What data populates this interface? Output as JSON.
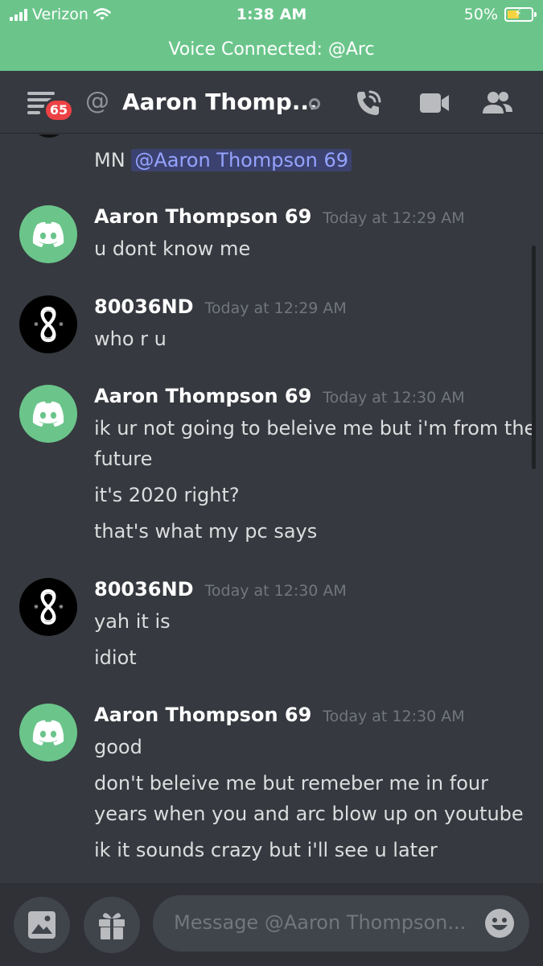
{
  "status_bar": {
    "carrier": "Verizon",
    "time": "1:38 AM",
    "battery": "50%"
  },
  "voice_bar": {
    "text": "Voice Connected: @Arc"
  },
  "header": {
    "badge_count": "65",
    "channel_name": "Aaron Thomp..."
  },
  "messages": {
    "partial": {
      "text": "MN",
      "mention": "@Aaron Thompson 69"
    },
    "groups": [
      {
        "author": "Aaron Thompson 69",
        "timestamp": "Today at 12:29 AM",
        "avatar": "discord-logo",
        "lines": [
          "u dont know me"
        ]
      },
      {
        "author": "80036ND",
        "timestamp": "Today at 12:29 AM",
        "avatar": "infinity-logo",
        "lines": [
          "who r u"
        ]
      },
      {
        "author": "Aaron Thompson 69",
        "timestamp": "Today at 12:30 AM",
        "avatar": "discord-logo",
        "lines": [
          "ik ur not going to beleive me but i'm from the",
          "future",
          "it's 2020 right?",
          "that's what my pc says"
        ]
      },
      {
        "author": "80036ND",
        "timestamp": "Today at 12:30 AM",
        "avatar": "infinity-logo",
        "lines": [
          "yah it is",
          "idiot"
        ]
      },
      {
        "author": "Aaron Thompson 69",
        "timestamp": "Today at 12:30 AM",
        "avatar": "discord-logo",
        "lines": [
          "good",
          "don't beleive me but remeber me in four",
          "years when you and arc blow up on youtube",
          "ik it sounds crazy but i'll see u later"
        ]
      }
    ]
  },
  "input": {
    "placeholder": "Message @Aaron Thompson..."
  },
  "colors": {
    "status_green": "#6bc58b",
    "background": "#36393f",
    "badge_red": "#ed4245",
    "mention_blue": "#95a3ff"
  }
}
